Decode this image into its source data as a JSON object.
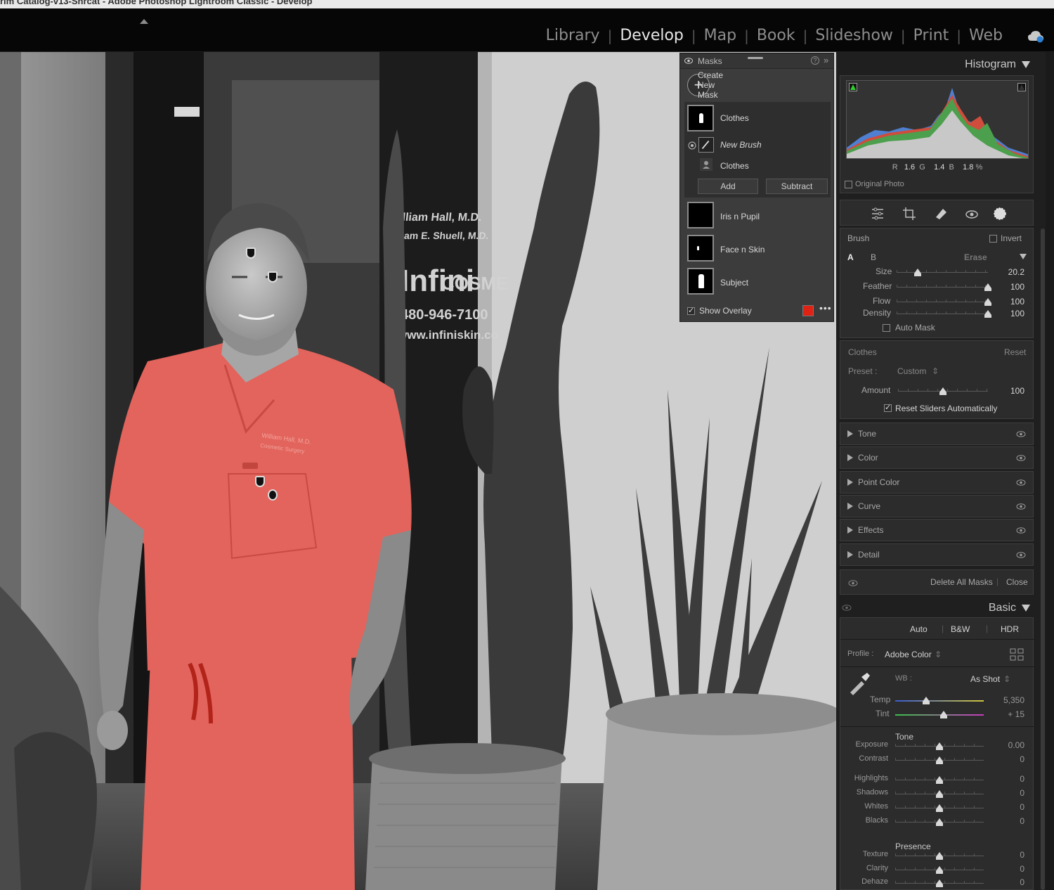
{
  "window_title": "rim Catalog-v13-Shrcat - Adobe Photoshop Lightroom Classic - Develop",
  "modules": [
    "Library",
    "Develop",
    "Map",
    "Book",
    "Slideshow",
    "Print",
    "Web"
  ],
  "active_module": "Develop",
  "photo": {
    "office_sign": [
      "William Hall, M.D.",
      "William E. Shuell, M.D.",
      "Infini",
      "COSME",
      "480-946-7100",
      "www.infiniskin.co"
    ],
    "scrubs_embroidery": [
      "William Hall, M.D.",
      "Cosmetic Surgery"
    ],
    "overlay_color": "#e2645c"
  },
  "masks_panel": {
    "title": "Masks",
    "create_label": "Create New Mask",
    "masks": [
      {
        "name": "Clothes",
        "selected": true
      },
      {
        "name": "Iris n Pupil"
      },
      {
        "name": "Face n Skin"
      },
      {
        "name": "Subject"
      }
    ],
    "components": [
      {
        "name": "New Brush",
        "italic": true
      },
      {
        "name": "Clothes"
      }
    ],
    "add_label": "Add",
    "subtract_label": "Subtract",
    "show_overlay_label": "Show Overlay",
    "show_overlay_checked": true,
    "overlay_swatch": "#e02214"
  },
  "histogram": {
    "title": "Histogram",
    "r_label": "R",
    "r": "1.6",
    "g_label": "G",
    "g": "1.4",
    "b_label": "B",
    "b": "1.8",
    "pct": "%",
    "original_photo_label": "Original Photo"
  },
  "brush": {
    "title": "Brush",
    "invert_label": "Invert",
    "tab_a": "A",
    "tab_b": "B",
    "erase": "Erase",
    "size_label": "Size",
    "size": "20.2",
    "size_frac": 0.23,
    "feather_label": "Feather",
    "feather": "100",
    "feather_frac": 1.0,
    "flow_label": "Flow",
    "flow": "100",
    "flow_frac": 1.0,
    "density_label": "Density",
    "density": "100",
    "density_frac": 1.0,
    "auto_mask_label": "Auto Mask"
  },
  "clothes_settings": {
    "title": "Clothes",
    "reset": "Reset",
    "preset_label": "Preset :",
    "preset_value": "Custom",
    "amount_label": "Amount",
    "amount": "100",
    "amount_frac": 0.5,
    "reset_sliders_label": "Reset Sliders Automatically"
  },
  "sections": [
    "Tone",
    "Color",
    "Point Color",
    "Curve",
    "Effects",
    "Detail"
  ],
  "delete_all_masks": "Delete All Masks",
  "close": "Close",
  "basic": {
    "title": "Basic",
    "auto": "Auto",
    "bw": "B&W",
    "hdr": "HDR",
    "profile_label": "Profile :",
    "profile_value": "Adobe Color",
    "wb_label": "WB :",
    "wb_value": "As Shot",
    "temp_label": "Temp",
    "temp": "5,350",
    "temp_frac": 0.35,
    "tint_label": "Tint",
    "tint": "+ 15",
    "tint_frac": 0.55,
    "tone_title": "Tone",
    "exposure_label": "Exposure",
    "exposure": "0.00",
    "contrast_label": "Contrast",
    "contrast": "0",
    "highlights_label": "Highlights",
    "highlights": "0",
    "shadows_label": "Shadows",
    "shadows": "0",
    "whites_label": "Whites",
    "whites": "0",
    "blacks_label": "Blacks",
    "blacks": "0",
    "presence_title": "Presence",
    "texture_label": "Texture",
    "texture": "0",
    "clarity_label": "Clarity",
    "clarity": "0",
    "dehaze_label": "Dehaze",
    "dehaze": "0"
  }
}
